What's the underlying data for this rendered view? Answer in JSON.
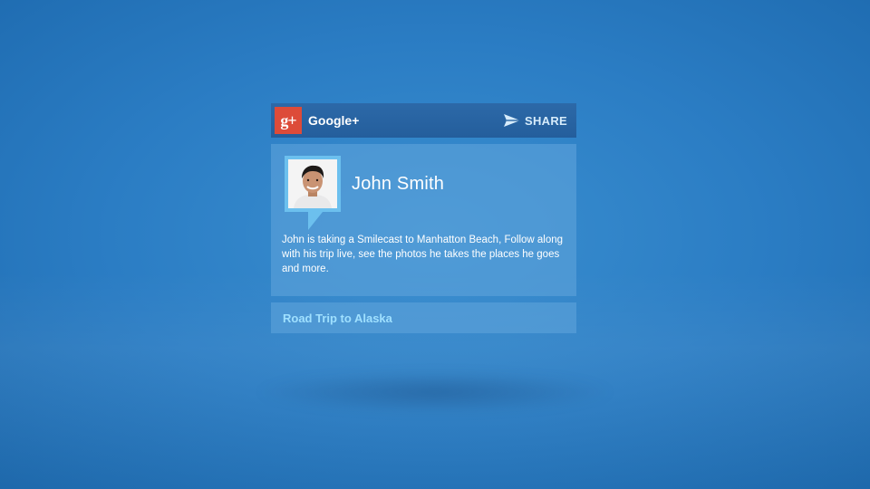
{
  "header": {
    "network_icon": "google-plus-icon",
    "network_icon_text": "g+",
    "network_name": "Google+",
    "share_icon": "paper-plane-icon",
    "share_label": "SHARE"
  },
  "post": {
    "avatar": "profile-photo",
    "user_name": "John Smith",
    "text": "John is taking a Smilecast to Manhatton Beach, Follow along with his trip live, see the photos he takes the places he goes and more."
  },
  "link": {
    "label": "Road Trip to Alaska"
  },
  "colors": {
    "background": "#2b7dc4",
    "header": "#2a66a5",
    "google_red": "#dd4b39",
    "avatar_border": "#6cc0ee",
    "link_text": "#9fe0ff"
  }
}
